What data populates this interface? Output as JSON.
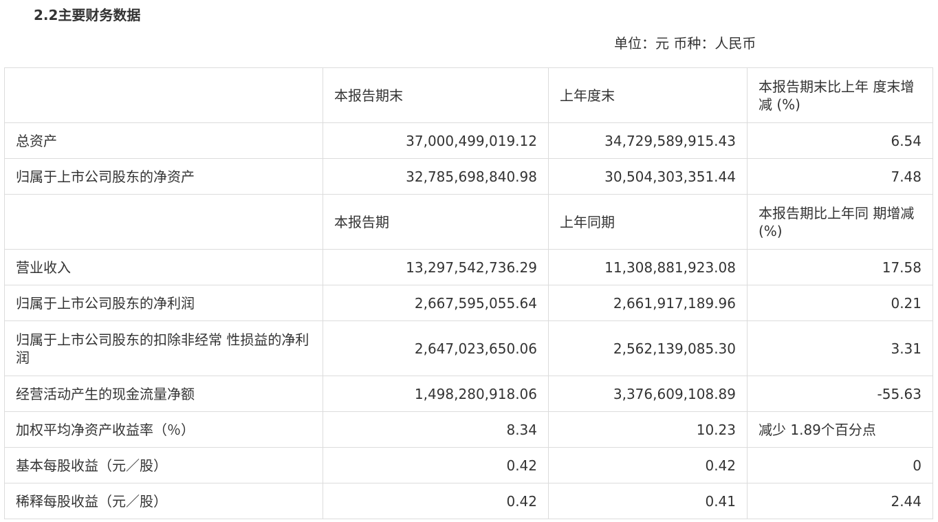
{
  "section_title": "2.2主要财务数据",
  "unit_line": "单位：元 币种：人民币",
  "header1": {
    "col0": "",
    "col1": "本报告期末",
    "col2": "上年度末",
    "col3": "本报告期末比上年 度末增减 (%)"
  },
  "balance_rows": [
    {
      "label": "总资产",
      "current": "37,000,499,019.12",
      "previous": "34,729,589,915.43",
      "change": "6.54"
    },
    {
      "label": "归属于上市公司股东的净资产",
      "current": "32,785,698,840.98",
      "previous": "30,504,303,351.44",
      "change": "7.48"
    }
  ],
  "header2": {
    "col0": "",
    "col1": "本报告期",
    "col2": "上年同期",
    "col3": "本报告期比上年同 期增减 (%)"
  },
  "income_rows": [
    {
      "label": "营业收入",
      "current": "13,297,542,736.29",
      "previous": "11,308,881,923.08",
      "change": "17.58"
    },
    {
      "label": "归属于上市公司股东的净利润",
      "current": "2,667,595,055.64",
      "previous": "2,661,917,189.96",
      "change": "0.21"
    },
    {
      "label": "归属于上市公司股东的扣除非经常 性损益的净利润",
      "current": "2,647,023,650.06",
      "previous": "2,562,139,085.30",
      "change": "3.31"
    },
    {
      "label": "经营活动产生的现金流量净额",
      "current": "1,498,280,918.06",
      "previous": "3,376,609,108.89",
      "change": "-55.63"
    },
    {
      "label": "加权平均净资产收益率（％）",
      "current": "8.34",
      "previous": "10.23",
      "change": "减少 1.89个百分点"
    },
    {
      "label": "基本每股收益（元／股）",
      "current": "0.42",
      "previous": "0.42",
      "change": "0"
    },
    {
      "label": "稀释每股收益（元／股）",
      "current": "0.42",
      "previous": "0.41",
      "change": "2.44"
    }
  ]
}
